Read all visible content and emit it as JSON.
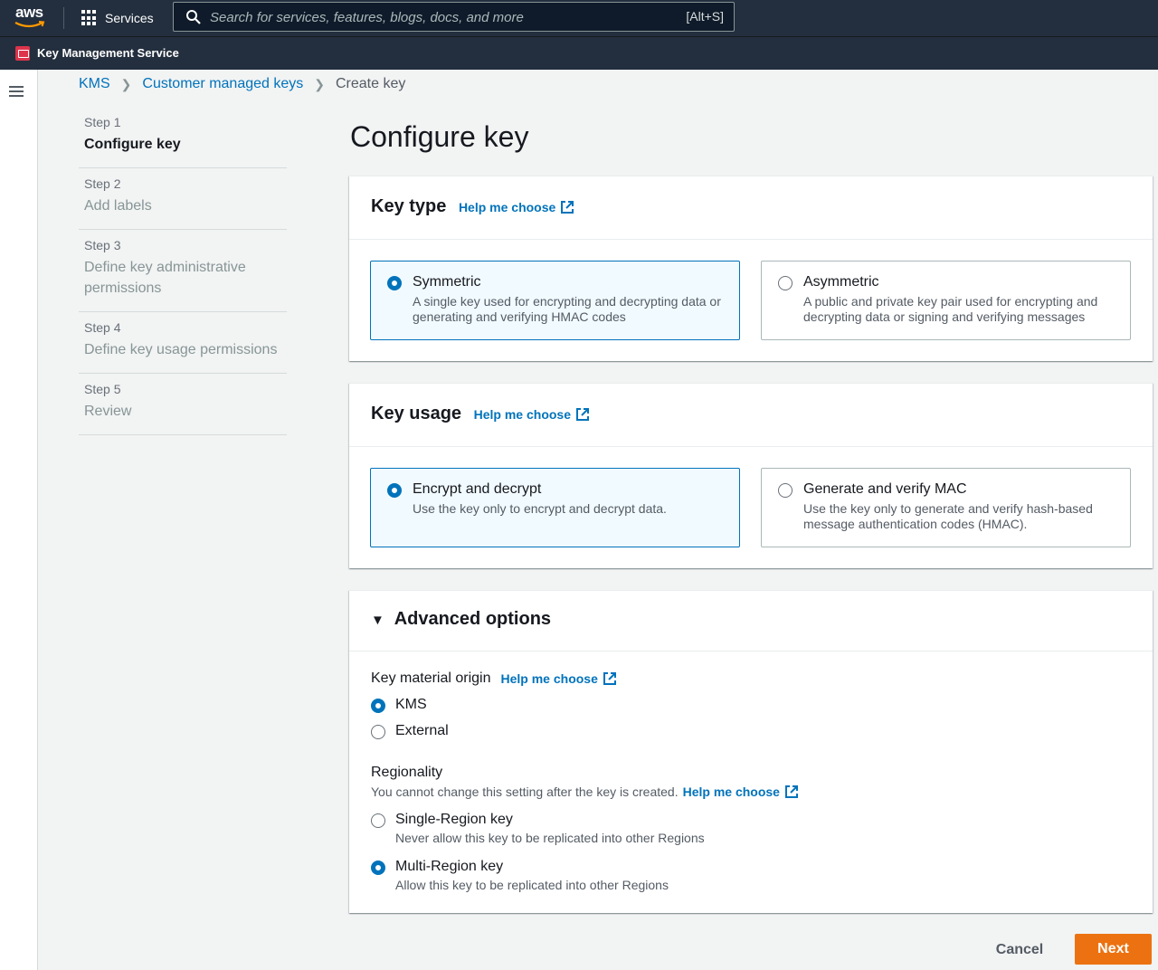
{
  "topnav": {
    "logo_text": "aws",
    "services_label": "Services",
    "search_placeholder": "Search for services, features, blogs, docs, and more",
    "search_shortcut": "[Alt+S]"
  },
  "service_bar": {
    "name": "Key Management Service"
  },
  "breadcrumb": {
    "items": [
      "KMS",
      "Customer managed keys",
      "Create key"
    ]
  },
  "steps": [
    {
      "num": "Step 1",
      "label": "Configure key"
    },
    {
      "num": "Step 2",
      "label": "Add labels"
    },
    {
      "num": "Step 3",
      "label": "Define key administrative permissions"
    },
    {
      "num": "Step 4",
      "label": "Define key usage permissions"
    },
    {
      "num": "Step 5",
      "label": "Review"
    }
  ],
  "page_title": "Configure key",
  "help_link": "Help me choose",
  "key_type": {
    "heading": "Key type",
    "options": [
      {
        "title": "Symmetric",
        "desc": "A single key used for encrypting and decrypting data or generating and verifying HMAC codes",
        "selected": true
      },
      {
        "title": "Asymmetric",
        "desc": "A public and private key pair used for encrypting and decrypting data or signing and verifying messages",
        "selected": false
      }
    ]
  },
  "key_usage": {
    "heading": "Key usage",
    "options": [
      {
        "title": "Encrypt and decrypt",
        "desc": "Use the key only to encrypt and decrypt data.",
        "selected": true
      },
      {
        "title": "Generate and verify MAC",
        "desc": "Use the key only to generate and verify hash-based message authentication codes (HMAC).",
        "selected": false
      }
    ]
  },
  "advanced": {
    "heading": "Advanced options",
    "origin_label": "Key material origin",
    "origin_options": [
      {
        "title": "KMS",
        "selected": true
      },
      {
        "title": "External",
        "selected": false
      }
    ],
    "regionality_label": "Regionality",
    "regionality_note": "You cannot change this setting after the key is created.",
    "regionality_options": [
      {
        "title": "Single-Region key",
        "desc": "Never allow this key to be replicated into other Regions",
        "selected": false
      },
      {
        "title": "Multi-Region key",
        "desc": "Allow this key to be replicated into other Regions",
        "selected": true
      }
    ]
  },
  "actions": {
    "cancel": "Cancel",
    "next": "Next"
  },
  "colors": {
    "nav_bg": "#232f3e",
    "link": "#0073bb",
    "primary_button": "#ec7211",
    "selected_tile_bg": "#f1faff"
  }
}
